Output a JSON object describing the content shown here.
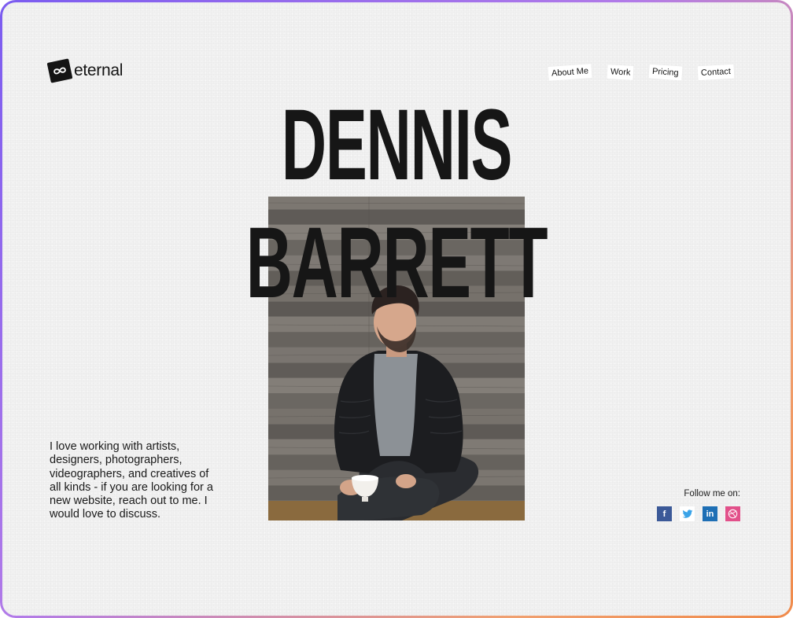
{
  "brand": {
    "name": "eternal",
    "logo_icon": "infinity-icon"
  },
  "nav": {
    "items": [
      {
        "label": "About Me"
      },
      {
        "label": "Work"
      },
      {
        "label": "Pricing"
      },
      {
        "label": "Contact"
      }
    ]
  },
  "hero": {
    "first_name": "DENNIS",
    "last_name": "BARRETT",
    "photo_icon": "portrait-photo"
  },
  "bio": {
    "text": "I love working with artists, designers, photographers, videographers, and creatives of all kinds - if you are looking for a new website, reach out to me. I would love to discuss."
  },
  "social": {
    "label": "Follow me on:",
    "items": [
      {
        "icon": "facebook-icon",
        "glyph": "f",
        "color": "#3b5998"
      },
      {
        "icon": "twitter-icon",
        "glyph": "",
        "color": "#ffffff"
      },
      {
        "icon": "linkedin-icon",
        "glyph": "in",
        "color": "#1e6fb5"
      },
      {
        "icon": "dribbble-icon",
        "glyph": "",
        "color": "#e2508a"
      }
    ]
  },
  "colors": {
    "background": "#f1f1f1",
    "text": "#161616",
    "frame_gradient_start": "#7b5cf0",
    "frame_gradient_end": "#f08a4a"
  }
}
